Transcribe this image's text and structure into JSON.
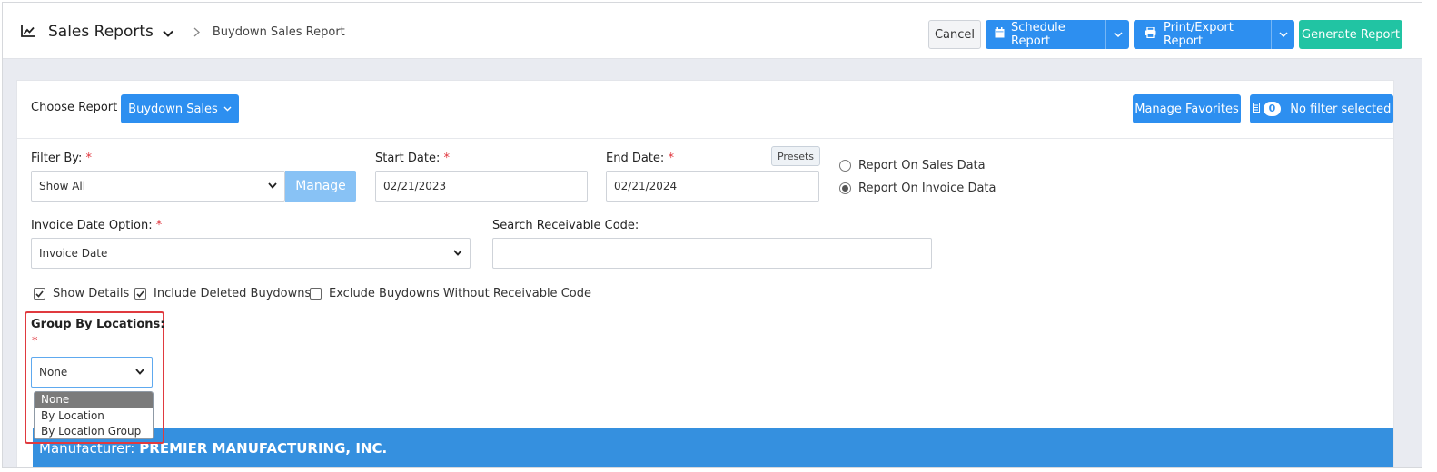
{
  "header": {
    "title": "Sales Reports",
    "breadcrumb": "Buydown Sales Report",
    "cancel_label": "Cancel",
    "schedule_label": "Schedule Report",
    "print_label": "Print/Export Report",
    "generate_label": "Generate Report"
  },
  "choose": {
    "label": "Choose Report",
    "report_button": "Buydown Sales",
    "favorites_label": "Manage Favorites",
    "filter_count": "0",
    "filter_label": "No filter selected"
  },
  "filters": {
    "filter_by_label": "Filter By:",
    "filter_by_value": "Show All",
    "manage_label": "Manage",
    "start_label": "Start Date:",
    "start_value": "02/21/2023",
    "end_label": "End Date:",
    "end_value": "02/21/2024",
    "presets_label": "Presets",
    "required_mark": "*",
    "radio_sales": "Report On Sales Data",
    "radio_invoice": "Report On Invoice Data",
    "invoice_option_label": "Invoice Date Option:",
    "invoice_option_value": "Invoice Date",
    "receivable_label": "Search Receivable Code:",
    "receivable_value": "",
    "chk_show_details": "Show Details",
    "chk_include_deleted": "Include Deleted Buydowns",
    "chk_exclude": "Exclude Buydowns Without Receivable Code",
    "group_label": "Group By Locations:",
    "group_value": "None",
    "group_options": [
      "None",
      "By Location",
      "By Location Group"
    ]
  },
  "result": {
    "manufacturer_label": "Manufacturer:",
    "manufacturer_name": "PREMIER MANUFACTURING, INC."
  },
  "colors": {
    "primary": "#2d8ff0",
    "success": "#21c4a3",
    "highlight": "#e03a3f",
    "manufacturer_bar": "#3590df"
  }
}
